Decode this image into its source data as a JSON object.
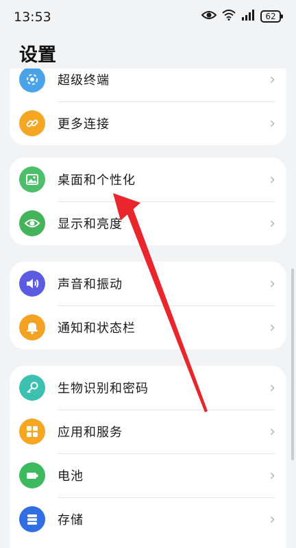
{
  "status_bar": {
    "time": "13:53",
    "battery": "62"
  },
  "title": "设置",
  "groups": [
    {
      "items": [
        {
          "label": "超级终端",
          "icon": "super-device-icon",
          "color": "#4aa3e8"
        },
        {
          "label": "更多连接",
          "icon": "link-icon",
          "color": "#f5a623"
        }
      ]
    },
    {
      "items": [
        {
          "label": "桌面和个性化",
          "icon": "image-icon",
          "color": "#4cbf6a"
        },
        {
          "label": "显示和亮度",
          "icon": "eye-icon",
          "color": "#45b35a"
        }
      ]
    },
    {
      "items": [
        {
          "label": "声音和振动",
          "icon": "speaker-icon",
          "color": "#5b5ce2"
        },
        {
          "label": "通知和状态栏",
          "icon": "bell-icon",
          "color": "#f4a224"
        }
      ]
    },
    {
      "items": [
        {
          "label": "生物识别和密码",
          "icon": "key-icon",
          "color": "#3cc1b0"
        },
        {
          "label": "应用和服务",
          "icon": "apps-icon",
          "color": "#f5a623"
        },
        {
          "label": "电池",
          "icon": "battery-icon",
          "color": "#3dba5d"
        },
        {
          "label": "存储",
          "icon": "storage-icon",
          "color": "#2f6fe3"
        }
      ]
    }
  ],
  "colors": {
    "background": "#f1f3f5",
    "arrow": "#e8262c"
  }
}
